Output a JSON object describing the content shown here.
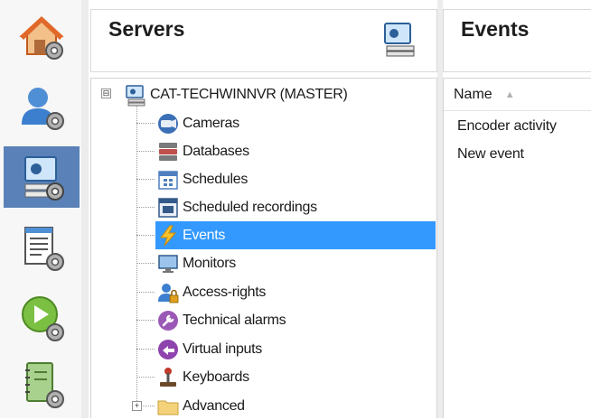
{
  "strip": {
    "items": [
      {
        "icon": "home-settings-icon",
        "active": false
      },
      {
        "icon": "user-settings-icon",
        "active": false
      },
      {
        "icon": "server-settings-icon",
        "active": true
      },
      {
        "icon": "list-settings-icon",
        "active": false
      },
      {
        "icon": "play-settings-icon",
        "active": false
      },
      {
        "icon": "notebook-settings-icon",
        "active": false
      }
    ]
  },
  "servers_panel": {
    "title": "Servers",
    "header_icon": "server-monitor-icon",
    "root": {
      "label": "CAT-TECHWINNVR (MASTER)",
      "icon": "server-icon",
      "expander": "⊟"
    },
    "items": [
      {
        "label": "Cameras",
        "icon": "camera-icon",
        "selected": false
      },
      {
        "label": "Databases",
        "icon": "database-icon",
        "selected": false
      },
      {
        "label": "Schedules",
        "icon": "calendar-icon",
        "selected": false
      },
      {
        "label": "Scheduled recordings",
        "icon": "scheduled-recording-icon",
        "selected": false
      },
      {
        "label": "Events",
        "icon": "lightning-icon",
        "selected": true
      },
      {
        "label": "Monitors",
        "icon": "monitor-icon",
        "selected": false
      },
      {
        "label": "Access-rights",
        "icon": "user-lock-icon",
        "selected": false
      },
      {
        "label": "Technical alarms",
        "icon": "wrench-icon",
        "selected": false
      },
      {
        "label": "Virtual inputs",
        "icon": "pointer-icon",
        "selected": false
      },
      {
        "label": "Keyboards",
        "icon": "joystick-icon",
        "selected": false
      },
      {
        "label": "Advanced",
        "icon": "folder-icon",
        "selected": false,
        "expander": "+"
      }
    ]
  },
  "events_panel": {
    "title": "Events",
    "column_header": "Name",
    "sort_indicator": "▲",
    "rows": [
      "Encoder activity",
      "New event"
    ]
  },
  "colors": {
    "selection": "#3399ff",
    "active_strip": "#5a82b8"
  }
}
